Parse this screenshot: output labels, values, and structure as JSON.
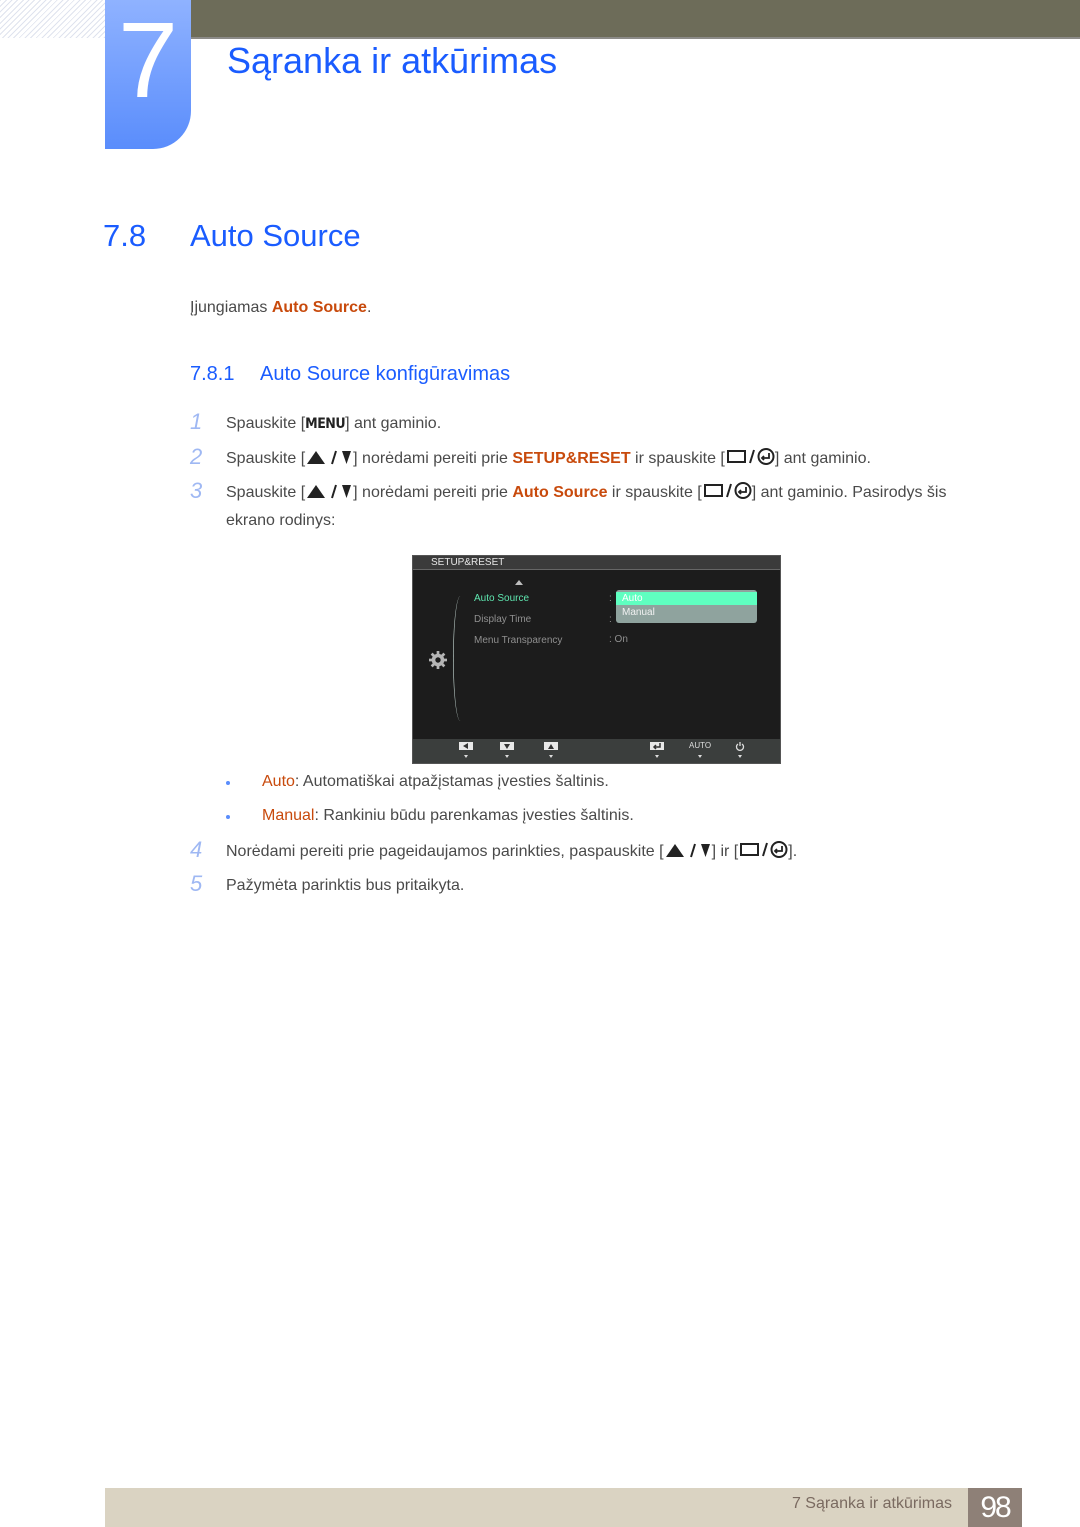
{
  "header": {
    "chapter_number": "7",
    "chapter_title": "Sąranka ir atkūrimas"
  },
  "section": {
    "number": "7.8",
    "title": "Auto Source",
    "intro_prefix": "Įjungiamas ",
    "intro_highlight": "Auto Source",
    "intro_suffix": "."
  },
  "subsection": {
    "number": "7.8.1",
    "title": "Auto Source konfigūravimas"
  },
  "steps": [
    {
      "n": "1",
      "a": "Spauskite [",
      "key": "MENU",
      "b": "] ant gaminio."
    },
    {
      "n": "2",
      "a": "Spauskite [",
      "b": "] norėdami pereiti prie ",
      "hl": "SETUP&RESET",
      "c": " ir spauskite [",
      "d": "] ant gaminio."
    },
    {
      "n": "3",
      "a": "Spauskite [",
      "b": "] norėdami pereiti prie ",
      "hl": "Auto Source",
      "c": " ir spauskite [",
      "d": "] ant gaminio. Pasirodys šis",
      "e": "ekrano rodinys:"
    },
    {
      "n": "4",
      "a": "Norėdami pereiti prie pageidaujamos parinkties, paspauskite [",
      "b": "] ir [",
      "c": "]."
    },
    {
      "n": "5",
      "a": "Pažymėta parinktis bus pritaikyta."
    }
  ],
  "bullets": [
    {
      "term": "Auto",
      "desc": ": Automatiškai atpažįstamas įvesties šaltinis."
    },
    {
      "term": "Manual",
      "desc": ": Rankiniu būdu parenkamas įvesties šaltinis."
    }
  ],
  "osd": {
    "menu_title": "SETUP&RESET",
    "items": [
      {
        "label": "Auto Source",
        "value": ""
      },
      {
        "label": "Display Time",
        "value": ""
      },
      {
        "label": "Menu Transparency",
        "value": ": On"
      }
    ],
    "dropdown_options": [
      "Auto",
      "Manual"
    ],
    "selected_option": "Auto",
    "auto_label": "AUTO"
  },
  "icons": {
    "up_down": "up-down-arrows-icon",
    "source_enter": "source-enter-icon",
    "menu_key": "menu-key"
  },
  "footer": {
    "chapter_label": "7 Sąranka ir atkūrimas",
    "page_number": "98"
  },
  "colors": {
    "heading_blue": "#1a5cff",
    "highlight_orange": "#c84a0c",
    "osd_selected": "#5fffc0",
    "footer_bar": "#dad3c2",
    "page_box": "#8e8077"
  }
}
